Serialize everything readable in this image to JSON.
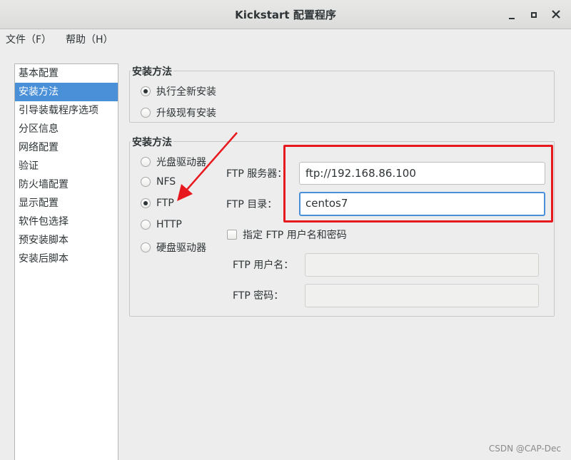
{
  "window": {
    "title": "Kickstart 配置程序",
    "controls": {
      "minimize_icon": "minimize-icon",
      "maximize_icon": "maximize-icon",
      "close_icon": "close-icon"
    }
  },
  "menubar": {
    "file": "文件（F）",
    "help": "帮助（H）"
  },
  "sidebar": {
    "items": [
      {
        "label": "基本配置"
      },
      {
        "label": "安装方法",
        "selected": true
      },
      {
        "label": "引导装载程序选项"
      },
      {
        "label": "分区信息"
      },
      {
        "label": "网络配置"
      },
      {
        "label": "验证"
      },
      {
        "label": "防火墙配置"
      },
      {
        "label": "显示配置"
      },
      {
        "label": "软件包选择"
      },
      {
        "label": "预安装脚本"
      },
      {
        "label": "安装后脚本"
      }
    ]
  },
  "install_type": {
    "title": "安装方法",
    "options": [
      {
        "label": "执行全新安装",
        "selected": true
      },
      {
        "label": "升级现有安装",
        "selected": false
      }
    ]
  },
  "install_method": {
    "title": "安装方法",
    "options": [
      {
        "label": "光盘驱动器",
        "selected": false
      },
      {
        "label": "NFS",
        "selected": false
      },
      {
        "label": "FTP",
        "selected": true
      },
      {
        "label": "HTTP",
        "selected": false
      },
      {
        "label": "硬盘驱动器",
        "selected": false
      }
    ],
    "ftp_server_label": "FTP 服务器：",
    "ftp_server_value": "ftp://192.168.86.100",
    "ftp_dir_label": "FTP 目录：",
    "ftp_dir_value": "centos7",
    "specify_credentials_label": "指定  FTP 用户名和密码",
    "specify_credentials_checked": false,
    "ftp_user_label": "FTP 用户名：",
    "ftp_user_value": "",
    "ftp_password_label": "FTP 密码：",
    "ftp_password_value": ""
  },
  "annotation": {
    "highlight_color": "#e8191e"
  },
  "watermark": "CSDN @CAP-Dec"
}
